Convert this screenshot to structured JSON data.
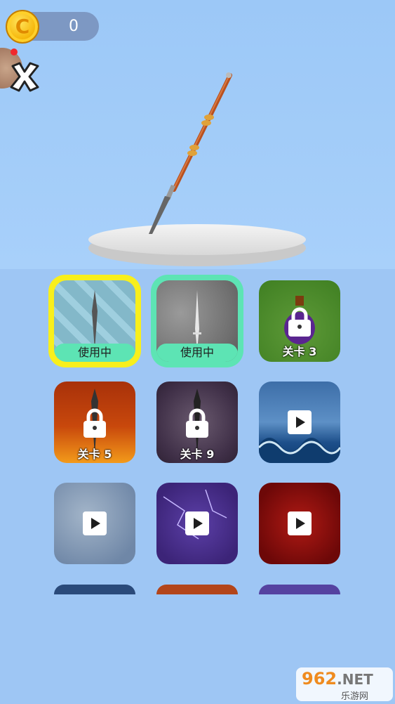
{
  "header": {
    "coin_count": "0",
    "coin_symbol": "C"
  },
  "items": [
    {
      "bg": "glass",
      "status": "in_use",
      "label": "使用中"
    },
    {
      "bg": "stone",
      "status": "in_use",
      "label": "使用中"
    },
    {
      "bg": "green",
      "status": "locked",
      "label": "关卡 3"
    },
    {
      "bg": "fire",
      "status": "locked",
      "label": "关卡 5"
    },
    {
      "bg": "smoke",
      "status": "locked",
      "label": "关卡 9"
    },
    {
      "bg": "wave",
      "status": "video",
      "label": ""
    },
    {
      "bg": "marble",
      "status": "video",
      "label": ""
    },
    {
      "bg": "lightning",
      "status": "video",
      "label": ""
    },
    {
      "bg": "red",
      "status": "video",
      "label": ""
    }
  ],
  "watermark": {
    "brand": "962",
    "suffix": ".NET",
    "subtitle": "乐游网"
  },
  "colors": {
    "selected_yellow": "#f8ef1c",
    "selected_green": "#5de4b4",
    "sky": "#9fc8f7"
  }
}
